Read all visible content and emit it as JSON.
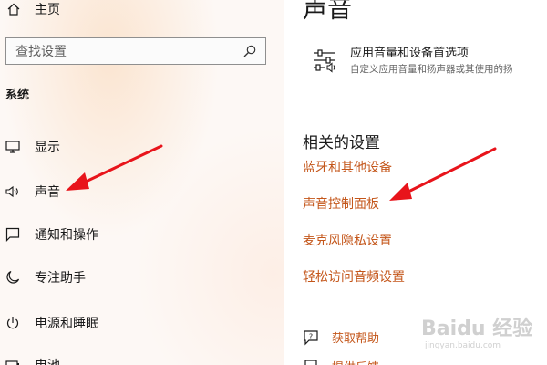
{
  "sidebar": {
    "home_label": "主页",
    "search_placeholder": "查找设置",
    "section_label": "系统",
    "items": [
      {
        "label": "显示",
        "icon": "monitor-icon"
      },
      {
        "label": "声音",
        "icon": "speaker-icon"
      },
      {
        "label": "通知和操作",
        "icon": "notification-icon"
      },
      {
        "label": "专注助手",
        "icon": "moon-icon"
      },
      {
        "label": "电源和睡眠",
        "icon": "power-icon"
      },
      {
        "label": "电池",
        "icon": "battery-icon"
      }
    ]
  },
  "main": {
    "page_title": "声音",
    "app_volume": {
      "title": "应用音量和设备首选项",
      "description": "自定义应用音量和扬声器或其使用的扬",
      "icon": "sliders-icon"
    },
    "related_title": "相关的设置",
    "related_links": [
      "蓝牙和其他设备",
      "声音控制面板",
      "麦克风隐私设置",
      "轻松访问音频设置"
    ],
    "help": [
      {
        "label": "获取帮助",
        "icon": "help-chat-icon"
      },
      {
        "label": "提供反馈",
        "icon": "feedback-icon"
      }
    ]
  },
  "watermark": {
    "logo": "Baidu 经验",
    "url": "jingyan.baidu.com"
  },
  "colors": {
    "link": "#c4561a",
    "arrow": "#e8141b",
    "text": "#1a1a1a"
  }
}
